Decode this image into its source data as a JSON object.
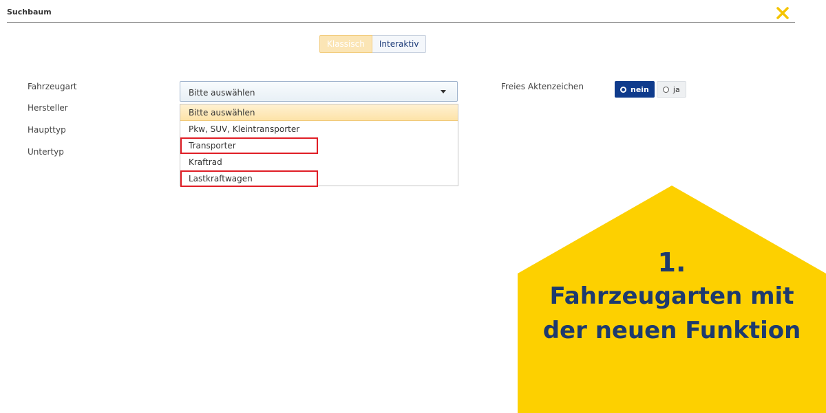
{
  "header": {
    "title": "Suchbaum"
  },
  "mode_toggle": {
    "classic": "Klassisch",
    "interactive": "Interaktiv"
  },
  "form": {
    "labels": {
      "vehicle_type": "Fahrzeugart",
      "manufacturer": "Hersteller",
      "main_type": "Haupttyp",
      "sub_type": "Untertyp",
      "free_file_number": "Freies Aktenzeichen"
    },
    "vehicle_select": {
      "value": "Bitte auswählen",
      "options": [
        "Bitte auswählen",
        "Pkw, SUV, Kleintransporter",
        "Transporter",
        "Kraftrad",
        "Lastkraftwagen"
      ]
    },
    "free_file_number_radio": {
      "nein": "nein",
      "ja": "ja",
      "selected": "nein"
    }
  },
  "promo": {
    "number": "1.",
    "line1": "Fahrzeugarten mit",
    "line2": "der neuen Funktion"
  },
  "colors": {
    "accent_yellow": "#fdd000",
    "brand_blue": "#0f3b8c",
    "highlight_red": "#e01d25"
  }
}
